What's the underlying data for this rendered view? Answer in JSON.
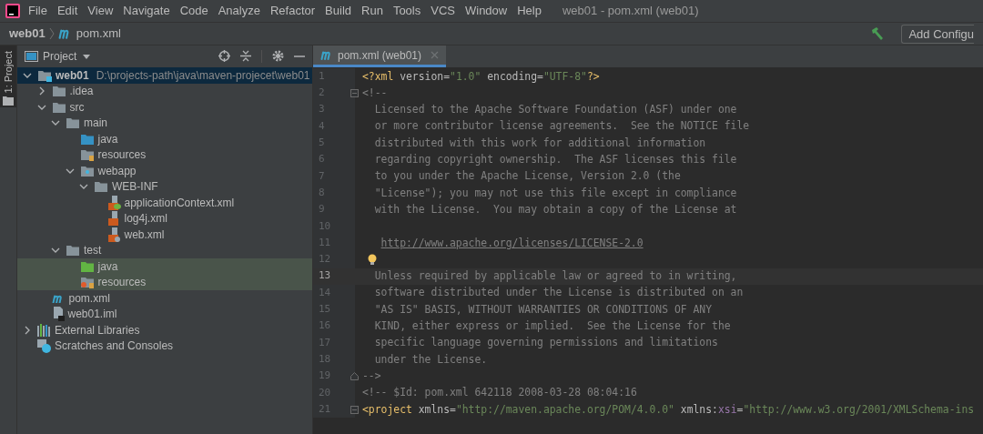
{
  "menu": [
    "File",
    "Edit",
    "View",
    "Navigate",
    "Code",
    "Analyze",
    "Refactor",
    "Build",
    "Run",
    "Tools",
    "VCS",
    "Window",
    "Help"
  ],
  "window_title": "web01 - pom.xml (web01)",
  "breadcrumb": [
    {
      "label": "web01",
      "kind": "project"
    },
    {
      "label": "pom.xml",
      "kind": "maven"
    }
  ],
  "run_config_button": "Add Configu",
  "tool_strip": {
    "label": "1: Project",
    "selected": true
  },
  "project_panel": {
    "title": "Project",
    "tree": [
      {
        "label": "web01",
        "path": "D:\\projects-path\\java\\maven-projecet\\web01",
        "kind": "module",
        "expanded": true,
        "selected": true,
        "children": [
          {
            "label": ".idea",
            "kind": "folder",
            "expanded": false,
            "selected": false
          },
          {
            "label": "src",
            "kind": "folder",
            "expanded": true,
            "selected": false,
            "children": [
              {
                "label": "main",
                "kind": "folder",
                "expanded": true,
                "selected": false,
                "children": [
                  {
                    "label": "java",
                    "kind": "source_folder",
                    "selected": false
                  },
                  {
                    "label": "resources",
                    "kind": "resources_folder",
                    "selected": false
                  },
                  {
                    "label": "webapp",
                    "kind": "web_folder",
                    "expanded": true,
                    "selected": false,
                    "children": [
                      {
                        "label": "WEB-INF",
                        "kind": "folder",
                        "expanded": true,
                        "selected": false,
                        "children": [
                          {
                            "label": "applicationContext.xml",
                            "kind": "spring_xml",
                            "selected": false
                          },
                          {
                            "label": "log4j.xml",
                            "kind": "xml",
                            "selected": false
                          },
                          {
                            "label": "web.xml",
                            "kind": "web_xml",
                            "selected": false
                          }
                        ]
                      }
                    ]
                  }
                ]
              },
              {
                "label": "test",
                "kind": "folder",
                "expanded": true,
                "selected": false,
                "children": [
                  {
                    "label": "java",
                    "kind": "test_source_folder",
                    "selected": false
                  },
                  {
                    "label": "resources",
                    "kind": "test_resources_folder",
                    "selected": false
                  }
                ]
              }
            ]
          },
          {
            "label": "pom.xml",
            "kind": "maven",
            "selected": false
          },
          {
            "label": "web01.iml",
            "kind": "iml",
            "selected": false
          }
        ]
      },
      {
        "label": "External Libraries",
        "kind": "libraries",
        "expanded": false,
        "selected": false
      },
      {
        "label": "Scratches and Consoles",
        "kind": "scratches",
        "selected": false
      }
    ]
  },
  "editor": {
    "tabs": [
      {
        "label": "pom.xml (web01)",
        "kind": "maven",
        "selected": true
      }
    ],
    "lines": [
      {
        "number": "1",
        "current": false,
        "tokens": [
          {
            "kind": "tag",
            "text": "<?xml"
          },
          {
            "kind": "attr",
            "text": " version="
          },
          {
            "kind": "value",
            "text": "\"1.0\""
          },
          {
            "kind": "attr",
            "text": " encoding="
          },
          {
            "kind": "value",
            "text": "\"UTF-8\""
          },
          {
            "kind": "tag",
            "text": "?>"
          }
        ]
      },
      {
        "number": "2",
        "current": false,
        "gutter": {
          "kind": "fold_start"
        },
        "tokens": [
          {
            "kind": "comment",
            "text": "<!--"
          }
        ]
      },
      {
        "number": "3",
        "current": false,
        "tokens": [
          {
            "kind": "comment",
            "text": "  Licensed to the Apache Software Foundation (ASF) under one"
          }
        ]
      },
      {
        "number": "4",
        "current": false,
        "tokens": [
          {
            "kind": "comment",
            "text": "  or more contributor license agreements.  See the NOTICE file"
          }
        ]
      },
      {
        "number": "5",
        "current": false,
        "tokens": [
          {
            "kind": "comment",
            "text": "  distributed with this work for additional information"
          }
        ]
      },
      {
        "number": "6",
        "current": false,
        "tokens": [
          {
            "kind": "comment",
            "text": "  regarding copyright ownership.  The ASF licenses this file"
          }
        ]
      },
      {
        "number": "7",
        "current": false,
        "tokens": [
          {
            "kind": "comment",
            "text": "  to you under the Apache License, Version 2.0 (the"
          }
        ]
      },
      {
        "number": "8",
        "current": false,
        "tokens": [
          {
            "kind": "comment",
            "text": "  \"License\"); you may not use this file except in compliance"
          }
        ]
      },
      {
        "number": "9",
        "current": false,
        "tokens": [
          {
            "kind": "comment",
            "text": "  with the License.  You may obtain a copy of the License at"
          }
        ]
      },
      {
        "number": "10",
        "current": false
      },
      {
        "number": "11",
        "current": false,
        "tokens": [
          {
            "kind": "link",
            "text": "http://www.apache.org/licenses/LICENSE-2.0"
          }
        ]
      },
      {
        "number": "12",
        "current": false,
        "gutter": {
          "kind": "bulb"
        }
      },
      {
        "number": "13",
        "current": true,
        "tokens": [
          {
            "kind": "comment",
            "text": "  Unless required by applicable law or agreed to in writing,"
          }
        ]
      },
      {
        "number": "14",
        "current": false,
        "tokens": [
          {
            "kind": "comment",
            "text": "  software distributed under the License is distributed on an"
          }
        ]
      },
      {
        "number": "15",
        "current": false,
        "tokens": [
          {
            "kind": "comment",
            "text": "  \"AS IS\" BASIS, WITHOUT WARRANTIES OR CONDITIONS OF ANY"
          }
        ]
      },
      {
        "number": "16",
        "current": false,
        "tokens": [
          {
            "kind": "comment",
            "text": "  KIND, either express or implied.  See the License for the"
          }
        ]
      },
      {
        "number": "17",
        "current": false,
        "tokens": [
          {
            "kind": "comment",
            "text": "  specific language governing permissions and limitations"
          }
        ]
      },
      {
        "number": "18",
        "current": false,
        "tokens": [
          {
            "kind": "comment",
            "text": "  under the License."
          }
        ]
      },
      {
        "number": "19",
        "current": false,
        "gutter": {
          "kind": "fold_end"
        },
        "tokens": [
          {
            "kind": "comment",
            "text": "-->"
          }
        ]
      },
      {
        "number": "20",
        "current": false,
        "tokens": [
          {
            "kind": "comment",
            "text": "<!-- $Id: pom.xml 642118 2008-03-28 08:04:16"
          }
        ]
      },
      {
        "number": "21",
        "current": false,
        "gutter": {
          "kind": "fold_start"
        },
        "tokens": [
          {
            "kind": "tag",
            "text": "<project"
          },
          {
            "kind": "attr",
            "text": " xmlns="
          },
          {
            "kind": "value",
            "text": "\"http://maven.apache.org/POM/4.0.0\""
          },
          {
            "kind": "attr",
            "text": " xmlns:"
          },
          {
            "kind": "ns",
            "text": "xsi"
          },
          {
            "kind": "attr",
            "text": "="
          },
          {
            "kind": "value",
            "text": "\"http://www.w3.org/2001/XMLSchema-ins"
          }
        ]
      }
    ]
  }
}
